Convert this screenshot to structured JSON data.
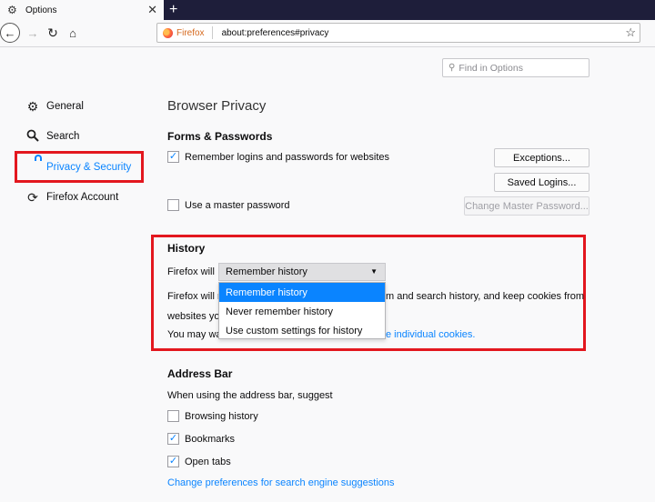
{
  "tab": {
    "title": "Options"
  },
  "nav": {
    "url": "about:preferences#privacy",
    "identity": "Firefox"
  },
  "search": {
    "placeholder": "Find in Options"
  },
  "sidebar": {
    "items": [
      {
        "label": "General",
        "icon": "gear-icon"
      },
      {
        "label": "Search",
        "icon": "search-icon"
      },
      {
        "label": "Privacy & Security",
        "icon": "lock-icon",
        "active": true
      },
      {
        "label": "Firefox Account",
        "icon": "sync-icon"
      }
    ]
  },
  "main": {
    "title": "Browser Privacy",
    "forms": {
      "heading": "Forms & Passwords",
      "remember_logins": "Remember logins and passwords for websites",
      "remember_logins_checked": true,
      "exceptions": "Exceptions...",
      "saved_logins": "Saved Logins...",
      "master_password": "Use a master password",
      "master_password_checked": false,
      "change_master": "Change Master Password..."
    },
    "history": {
      "heading": "History",
      "firefox_will": "Firefox will",
      "selected": "Remember history",
      "options": [
        "Remember history",
        "Never remember history",
        "Use custom settings for history"
      ],
      "desc_line1_start": "Firefox will r",
      "desc_line1_end": "m and search history, and keep cookies from",
      "desc_line2_start": "websites you",
      "desc_line3_start": "You may wa",
      "desc_line3_link": "e individual cookies."
    },
    "address": {
      "heading": "Address Bar",
      "intro": "When using the address bar, suggest",
      "browsing_history": "Browsing history",
      "browsing_history_checked": false,
      "bookmarks": "Bookmarks",
      "bookmarks_checked": true,
      "open_tabs": "Open tabs",
      "open_tabs_checked": true,
      "change_link": "Change preferences for search engine suggestions"
    }
  },
  "colors": {
    "accent": "#0a84ff",
    "highlight": "#e3171e"
  }
}
